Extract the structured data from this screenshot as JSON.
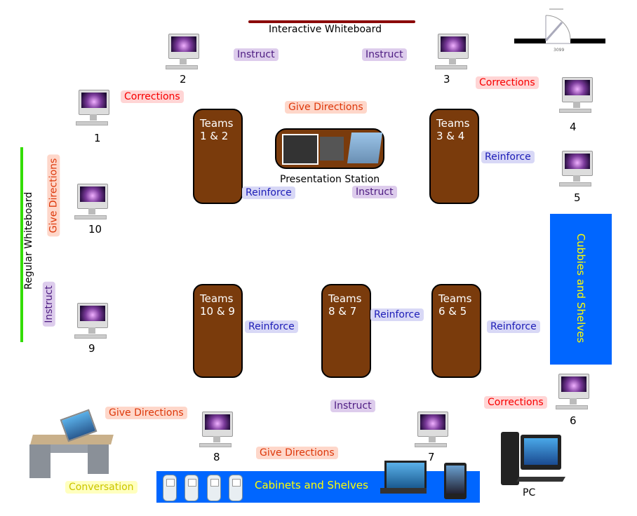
{
  "whiteboards": {
    "interactive": "Interactive Whiteboard",
    "regular": "Regular Whiteboard"
  },
  "door": {
    "label": "3099"
  },
  "computers": [
    "1",
    "2",
    "3",
    "4",
    "5",
    "6",
    "7",
    "8",
    "9",
    "10"
  ],
  "tables": [
    {
      "line1": "Teams",
      "line2": "1 & 2"
    },
    {
      "line1": "Teams",
      "line2": "3 & 4"
    },
    {
      "line1": "Teams",
      "line2": "10 & 9"
    },
    {
      "line1": "Teams",
      "line2": "8 & 7"
    },
    {
      "line1": "Teams",
      "line2": "6 & 5"
    }
  ],
  "presentation_station": "Presentation Station",
  "labels": [
    {
      "text": "Corrections",
      "kind": "corr"
    },
    {
      "text": "Instruct",
      "kind": "ins"
    },
    {
      "text": "Instruct",
      "kind": "ins"
    },
    {
      "text": "Corrections",
      "kind": "corr"
    },
    {
      "text": "Give Directions",
      "kind": "dir"
    },
    {
      "text": "Reinforce",
      "kind": "rein"
    },
    {
      "text": "Reinforce",
      "kind": "rein"
    },
    {
      "text": "Instruct",
      "kind": "ins"
    },
    {
      "text": "Reinforce",
      "kind": "rein"
    },
    {
      "text": "Reinforce",
      "kind": "rein"
    },
    {
      "text": "Reinforce",
      "kind": "rein"
    },
    {
      "text": "Instruct",
      "kind": "ins"
    },
    {
      "text": "Corrections",
      "kind": "corr"
    },
    {
      "text": "Give Directions",
      "kind": "dir"
    },
    {
      "text": "Give Directions",
      "kind": "dir"
    },
    {
      "text": "Conversation",
      "kind": "conv"
    },
    {
      "text": "Give Directions",
      "kind": "dir"
    },
    {
      "text": "Instruct",
      "kind": "ins"
    }
  ],
  "cubbies": "Cubbies and Shelves",
  "cabinets": "Cabinets and Shelves",
  "pc_label": "PC",
  "colors": {
    "table": "#7a3b0c",
    "storage": "#0066ff",
    "storage_text": "#ffff00",
    "interactive_whiteboard": "#8b0a0a",
    "regular_whiteboard": "#33dd00"
  }
}
